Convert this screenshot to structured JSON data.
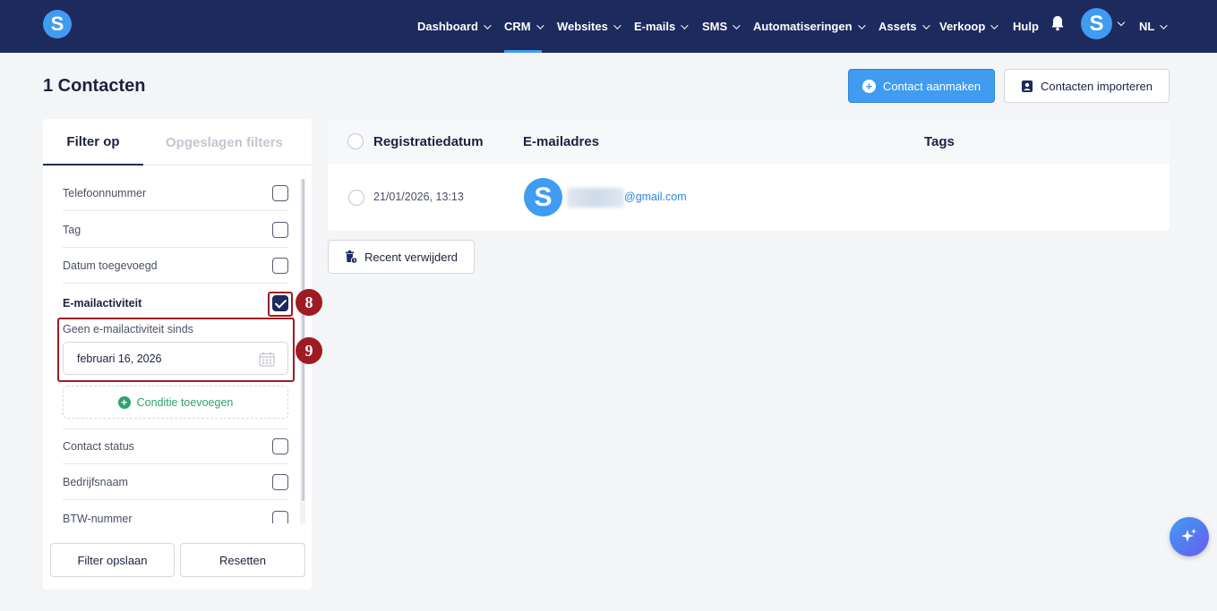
{
  "topbar": {
    "logo_letter": "S",
    "nav": [
      {
        "label": "Dashboard",
        "has_chevron": true
      },
      {
        "label": "CRM",
        "has_chevron": true,
        "active": true
      },
      {
        "label": "Websites",
        "has_chevron": true
      },
      {
        "label": "E-mails",
        "has_chevron": true
      },
      {
        "label": "SMS",
        "has_chevron": true
      },
      {
        "label": "Automatiseringen",
        "has_chevron": true
      },
      {
        "label": "Assets",
        "has_chevron": true
      },
      {
        "label": "Verkoop",
        "has_chevron": true
      },
      {
        "label": "Hulp",
        "has_chevron": false
      }
    ],
    "icons": {
      "notifications": "bell-icon"
    },
    "user_avatar_letter": "S",
    "language": "NL",
    "colors": {
      "background": "#1d2a5d",
      "accent": "#3f9cf0"
    }
  },
  "header": {
    "title": "1 Contacten",
    "create_button": "Contact aanmaken",
    "import_button": "Contacten importeren"
  },
  "filters": {
    "tabs": [
      {
        "label": "Filter op",
        "active": true
      },
      {
        "label": "Opgeslagen filters",
        "active": false
      }
    ],
    "items": [
      {
        "label": "Telefoonnummer",
        "checked": false
      },
      {
        "label": "Tag",
        "checked": false
      },
      {
        "label": "Datum toegevoegd",
        "checked": false
      },
      {
        "label": "E-mailactiviteit",
        "checked": true
      },
      {
        "label": "Contact status",
        "checked": false
      },
      {
        "label": "Bedrijfsnaam",
        "checked": false
      },
      {
        "label": "BTW-nummer",
        "checked": false
      }
    ],
    "email_activity": {
      "label": "Geen e-mailactiviteit sinds",
      "date_value": "februari 16, 2026",
      "add_condition": "Conditie toevoegen"
    },
    "save_button": "Filter opslaan",
    "reset_button": "Resetten"
  },
  "annotations": [
    {
      "number": "8"
    },
    {
      "number": "9"
    }
  ],
  "table": {
    "columns": [
      "Registratiedatum",
      "E-mailadres",
      "Tags"
    ],
    "rows": [
      {
        "date": "21/01/2026, 13:13",
        "avatar_letter": "S",
        "email": "@gmail.com",
        "tags": ""
      }
    ]
  },
  "recently_deleted_button": "Recent verwijderd"
}
